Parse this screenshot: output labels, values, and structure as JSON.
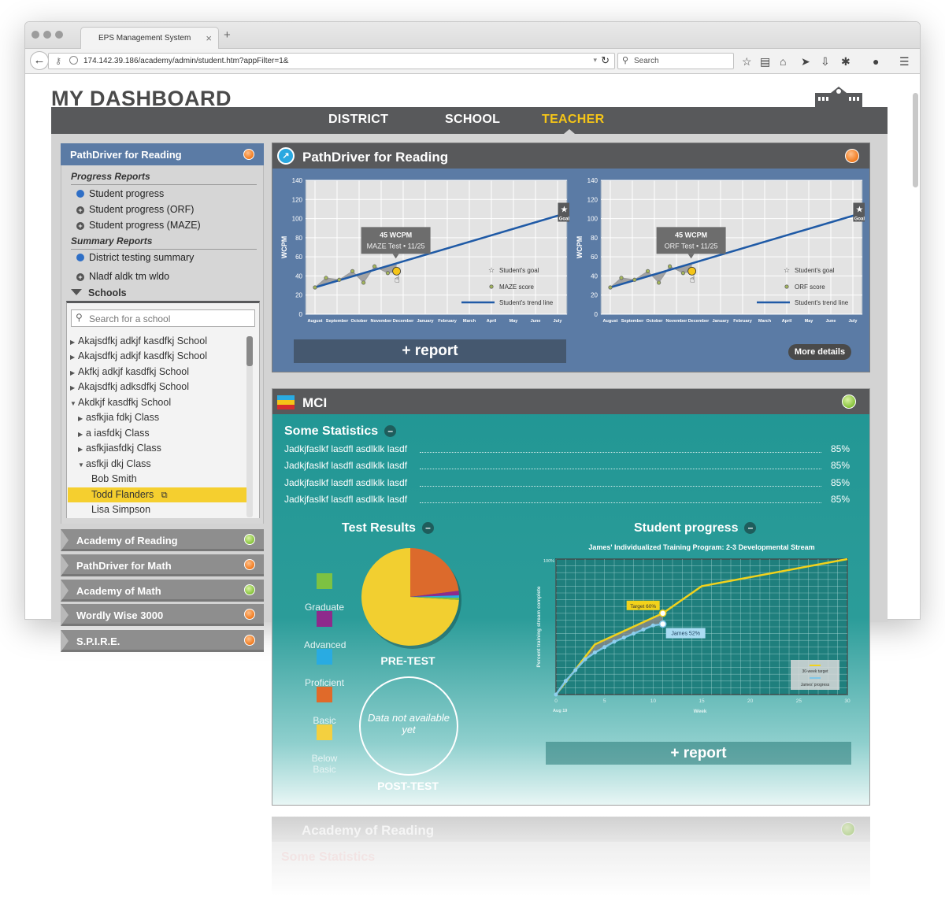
{
  "browser": {
    "tab_title": "EPS Management System",
    "url": "174.142.39.186/academy/admin/student.htm?appFilter=1&",
    "search_placeholder": "Search"
  },
  "page": {
    "title": "MY DASHBOARD",
    "nav": {
      "district": "DISTRICT",
      "school": "SCHOOL",
      "teacher": "TEACHER",
      "active": "TEACHER"
    }
  },
  "sidebar": {
    "header": "PathDriver for Reading",
    "progress_reports_label": "Progress Reports",
    "progress_items": [
      "Student progress",
      "Student progress (ORF)",
      "Student progress (MAZE)"
    ],
    "summary_reports_label": "Summary Reports",
    "summary_items": [
      "District testing summary",
      "Nladf aldk tm wldo"
    ],
    "schools_label": "Schools",
    "search_placeholder": "Search for a school",
    "tree": [
      "Akajsdfkj adkjf kasdfkj School",
      "Akajsdfkj adkjf kasdfkj School",
      "Akfkj adkjf kasdfkj School",
      "Akajsdfkj adksdfkj School",
      "Akdkjf kasdfkj School",
      "asfkjia fdkj  Class",
      "a iasfdkj  Class",
      "asfkjiasfdkj  Class",
      "asfkji dkj  Class",
      "Bob Smith",
      "Todd Flanders",
      "Lisa Simpson"
    ],
    "selected_student": "Todd Flanders",
    "accordion": [
      {
        "label": "Academy of Reading",
        "status": "green"
      },
      {
        "label": "PathDriver for Math",
        "status": "orange"
      },
      {
        "label": "Academy of Math",
        "status": "green"
      },
      {
        "label": "Wordly Wise 3000",
        "status": "orange"
      },
      {
        "label": "S.P.I.R.E.",
        "status": "orange"
      }
    ]
  },
  "pathdriver": {
    "title": "PathDriver for Reading",
    "report_button": "+ report",
    "more_details_button": "More details",
    "charts": [
      {
        "tooltip_value": "45 WCPM",
        "tooltip_sub": "MAZE Test • 11/25",
        "score_legend": "MAZE score"
      },
      {
        "tooltip_value": "45 WCPM",
        "tooltip_sub": "ORF Test • 11/25",
        "score_legend": "ORF score"
      }
    ],
    "goal_legend": "Student's goal",
    "trend_legend": "Student's trend line",
    "goal_badge": "Goal"
  },
  "mci": {
    "title": "MCI",
    "statistics_title": "Some Statistics",
    "statistics": [
      {
        "label": "Jadkjfaslkf  lasdfl asdlklk  lasdf",
        "value": "85%"
      },
      {
        "label": "Jadkjfaslkf  lasdfl asdlklk  lasdf",
        "value": "85%"
      },
      {
        "label": "Jadkjfaslkf  lasdfl asdlklk  lasdf",
        "value": "85%"
      },
      {
        "label": "Jadkjfaslkf  lasdfl asdlklk  lasdf",
        "value": "85%"
      }
    ],
    "test_results_title": "Test Results",
    "legend": [
      {
        "label": "Graduate",
        "color": "#7dc242"
      },
      {
        "label": "Advanced",
        "color": "#8e2a8c"
      },
      {
        "label": "Proficient",
        "color": "#29abe2"
      },
      {
        "label": "Basic",
        "color": "#e06a2a"
      },
      {
        "label": "Below Basic",
        "color": "#f4d03f"
      }
    ],
    "pre_test_label": "PRE-TEST",
    "post_test_label": "POST-TEST",
    "post_test_text": "Data not available yet",
    "student_progress_title": "Student progress",
    "report_button": "+ report"
  },
  "ghost_panel": {
    "title": "Academy of Reading",
    "sub": "Some Statistics"
  },
  "chart_data": [
    {
      "type": "line",
      "title": "",
      "xlabel": "",
      "ylabel": "WCPM",
      "categories": [
        "August",
        "September",
        "October",
        "November",
        "December",
        "January",
        "February",
        "March",
        "April",
        "May",
        "June",
        "July"
      ],
      "ylim": [
        0,
        140
      ],
      "yticks": [
        0,
        20,
        40,
        60,
        80,
        100,
        120,
        140
      ],
      "series": [
        {
          "name": "MAZE score",
          "points": [
            [
              0,
              28
            ],
            [
              0.5,
              38
            ],
            [
              1.1,
              36
            ],
            [
              1.7,
              45
            ],
            [
              2.2,
              33
            ],
            [
              2.7,
              50
            ],
            [
              3.3,
              43
            ],
            [
              3.7,
              45
            ]
          ]
        },
        {
          "name": "Student's trend line",
          "points": [
            [
              0,
              28
            ],
            [
              11.3,
              105
            ]
          ]
        }
      ],
      "goal": {
        "x": 11.3,
        "y": 105
      }
    },
    {
      "type": "line",
      "title": "",
      "xlabel": "",
      "ylabel": "WCPM",
      "categories": [
        "August",
        "September",
        "October",
        "November",
        "December",
        "January",
        "February",
        "March",
        "April",
        "May",
        "June",
        "July"
      ],
      "ylim": [
        0,
        140
      ],
      "yticks": [
        0,
        20,
        40,
        60,
        80,
        100,
        120,
        140
      ],
      "series": [
        {
          "name": "ORF score",
          "points": [
            [
              0,
              28
            ],
            [
              0.5,
              38
            ],
            [
              1.1,
              36
            ],
            [
              1.7,
              45
            ],
            [
              2.2,
              33
            ],
            [
              2.7,
              50
            ],
            [
              3.3,
              43
            ],
            [
              3.7,
              45
            ]
          ]
        },
        {
          "name": "Student's trend line",
          "points": [
            [
              0,
              28
            ],
            [
              11.3,
              105
            ]
          ]
        }
      ],
      "goal": {
        "x": 11.3,
        "y": 105
      }
    },
    {
      "type": "pie",
      "title": "PRE-TEST",
      "categories": [
        "Below Basic",
        "Basic",
        "Advanced",
        "Proficient",
        "Graduate"
      ],
      "values": [
        74,
        23,
        1.5,
        0.8,
        0.7
      ],
      "colors": [
        "#f2cf30",
        "#dc6a2c",
        "#8e2a8c",
        "#29abe2",
        "#7dc242"
      ]
    },
    {
      "type": "line",
      "title": "James' Individualized Training Program:  2-3 Developmental Stream",
      "xlabel": "Week",
      "ylabel": "Percent training stream complete",
      "xlim": [
        0,
        30
      ],
      "ylim": [
        0,
        100
      ],
      "xticks": [
        0,
        5,
        10,
        15,
        20,
        25,
        30
      ],
      "x_start_label": "Aug 19",
      "ytop_label": "100%",
      "series": [
        {
          "name": "30-week target",
          "points": [
            [
              0,
              0
            ],
            [
              4,
              37
            ],
            [
              11,
              60
            ],
            [
              15,
              80
            ],
            [
              30,
              100
            ]
          ]
        },
        {
          "name": "James' progress",
          "points": [
            [
              0,
              0
            ],
            [
              1,
              10
            ],
            [
              2,
              18
            ],
            [
              3,
              26
            ],
            [
              4,
              31
            ],
            [
              5,
              35
            ],
            [
              6,
              39
            ],
            [
              7,
              42
            ],
            [
              8,
              45
            ],
            [
              9,
              48
            ],
            [
              10,
              51
            ],
            [
              11,
              52
            ]
          ]
        }
      ],
      "annotations": [
        {
          "label": "Target  60%",
          "x": 11,
          "y": 60
        },
        {
          "label": "James  52%",
          "x": 11,
          "y": 52
        }
      ]
    }
  ]
}
